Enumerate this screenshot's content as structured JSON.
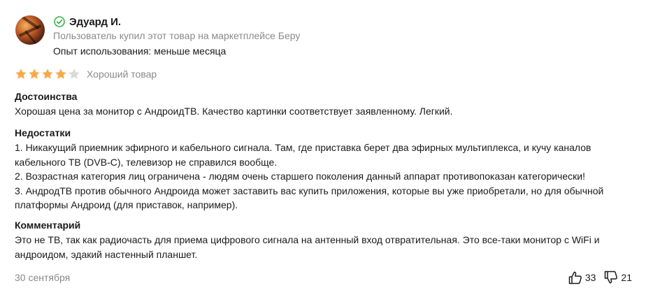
{
  "author": {
    "name": "Эдуард И.",
    "source": "Пользователь купил этот товар на маркетплейсе Беру",
    "usage": "Опыт использования: меньше месяца",
    "verified_color": "#3bb24a"
  },
  "rating": {
    "value": 4,
    "max": 5,
    "label": "Хороший товар",
    "filled_color": "#f7a84a",
    "empty_color": "#d9d9d9"
  },
  "pros": {
    "title": "Достоинства",
    "text": "Хорошая цена за монитор с АндроидТВ. Качество картинки соответствует заявленному. Легкий."
  },
  "cons": {
    "title": "Недостатки",
    "lines": [
      "1. Никакущий приемник эфирного и кабельного сигнала. Там, где приставка берет два эфирных мультиплекса, и кучу каналов",
      "кабельного ТВ (DVB-C), телевизор не справился вообще.",
      "2. Возрастная категория лиц ограничена - людям очень старшего поколения данный аппарат противопоказан категорически!",
      "3. АндродТВ против обычного Андроида может заставить вас купить приложения, которые вы уже приобретали, но для обычной",
      "платформы Андроид (для приставок, например)."
    ]
  },
  "comment": {
    "title": "Комментарий",
    "lines": [
      "Это не ТВ, так как радиочасть для приема цифрового сигнала на антенный вход отвратительная. Это все-таки монитор с WiFi и",
      "андроидом, эдакий настенный планшет."
    ]
  },
  "date": "30 сентября",
  "votes": {
    "likes": "33",
    "dislikes": "21"
  }
}
